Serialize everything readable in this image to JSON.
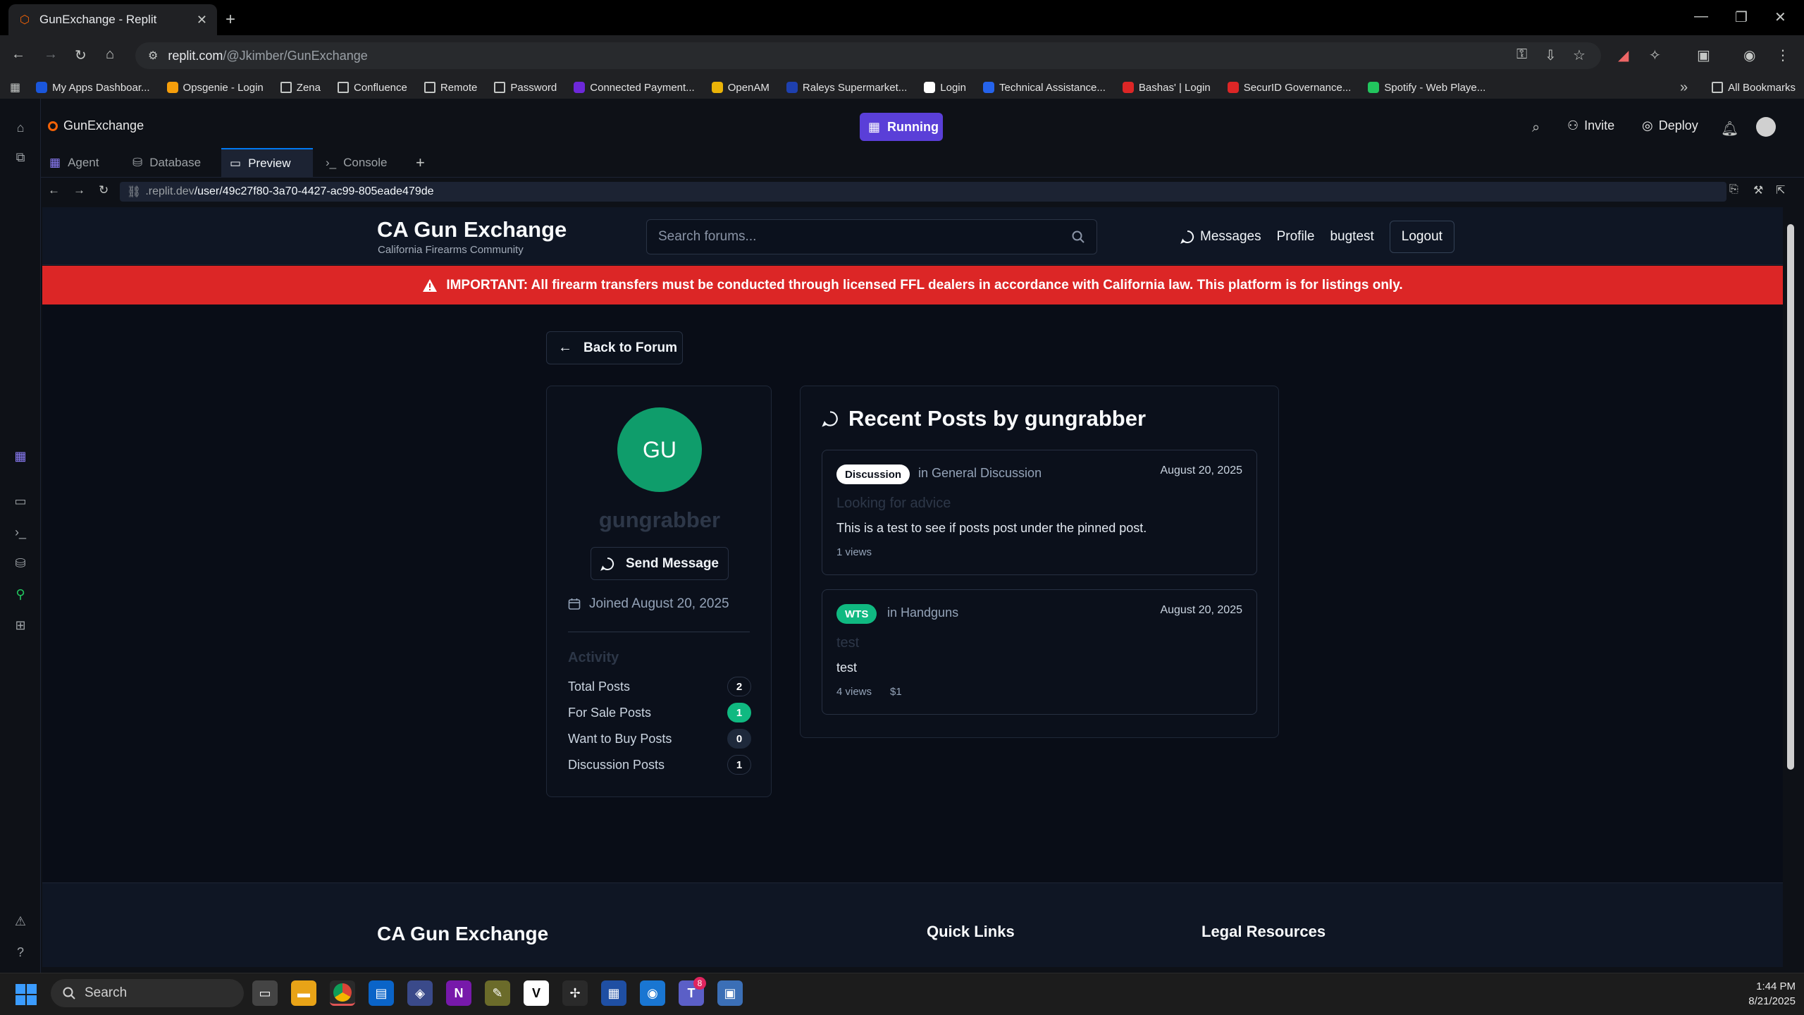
{
  "browser": {
    "tab_title": "GunExchange - Replit",
    "url_host": "replit.com",
    "url_path": "/@Jkimber/GunExchange",
    "bookmarks": [
      {
        "label": "My Apps Dashboar...",
        "color": "#1a56db"
      },
      {
        "label": "Opsgenie - Login",
        "color": "#f59e0b"
      },
      {
        "label": "Zena",
        "color": "folder"
      },
      {
        "label": "Confluence",
        "color": "folder"
      },
      {
        "label": "Remote",
        "color": "folder"
      },
      {
        "label": "Password",
        "color": "folder"
      },
      {
        "label": "Connected Payment...",
        "color": "#6d28d9"
      },
      {
        "label": "OpenAM",
        "color": "#eab308"
      },
      {
        "label": "Raleys Supermarket...",
        "color": "#1e40af"
      },
      {
        "label": "Login",
        "color": "#ffffff"
      },
      {
        "label": "Technical Assistance...",
        "color": "#2563eb"
      },
      {
        "label": "Bashas' | Login",
        "color": "#dc2626"
      },
      {
        "label": "SecurID Governance...",
        "color": "#dc2626"
      },
      {
        "label": "Spotify - Web Playe...",
        "color": "#22c55e"
      }
    ],
    "all_bookmarks": "All Bookmarks"
  },
  "replit": {
    "project_name": "GunExchange",
    "status": "Running",
    "invite": "Invite",
    "deploy": "Deploy",
    "tabs": [
      "Agent",
      "Database",
      "Preview",
      "Console"
    ],
    "active_tab": "Preview",
    "preview_url_host": ".replit.dev",
    "preview_url_path": "/user/49c27f80-3a70-4427-ac99-805eade479de"
  },
  "site": {
    "title": "CA Gun Exchange",
    "subtitle": "California Firearms Community",
    "search_placeholder": "Search forums...",
    "nav": {
      "messages": "Messages",
      "profile": "Profile",
      "user": "bugtest",
      "logout": "Logout"
    },
    "alert": "IMPORTANT: All firearm transfers must be conducted through licensed FFL dealers in accordance with California law. This platform is for listings only.",
    "back": "Back to Forum"
  },
  "profile": {
    "initials": "GU",
    "username": "gungrabber",
    "send_message": "Send Message",
    "joined": "Joined August 20, 2025",
    "activity_title": "Activity",
    "stats": [
      {
        "label": "Total Posts",
        "value": "2",
        "style": "outline"
      },
      {
        "label": "For Sale Posts",
        "value": "1",
        "style": "green"
      },
      {
        "label": "Want to Buy Posts",
        "value": "0",
        "style": "dark"
      },
      {
        "label": "Discussion Posts",
        "value": "1",
        "style": "outline"
      }
    ]
  },
  "recent_posts": {
    "heading": "Recent Posts by gungrabber",
    "posts": [
      {
        "tag": "Discussion",
        "category": "in General Discussion",
        "date": "August 20, 2025",
        "title": "Looking for advice",
        "body": "This is a test to see if posts post under the pinned post.",
        "views": "1 views",
        "price": ""
      },
      {
        "tag": "WTS",
        "category": "in Handguns",
        "date": "August 20, 2025",
        "title": "test",
        "body": "test",
        "views": "4 views",
        "price": "$1"
      }
    ]
  },
  "footer": {
    "brand": "CA Gun Exchange",
    "quick_links": "Quick Links",
    "legal": "Legal Resources"
  },
  "taskbar": {
    "search": "Search",
    "time": "1:44 PM",
    "date": "8/21/2025",
    "badge": "8"
  }
}
